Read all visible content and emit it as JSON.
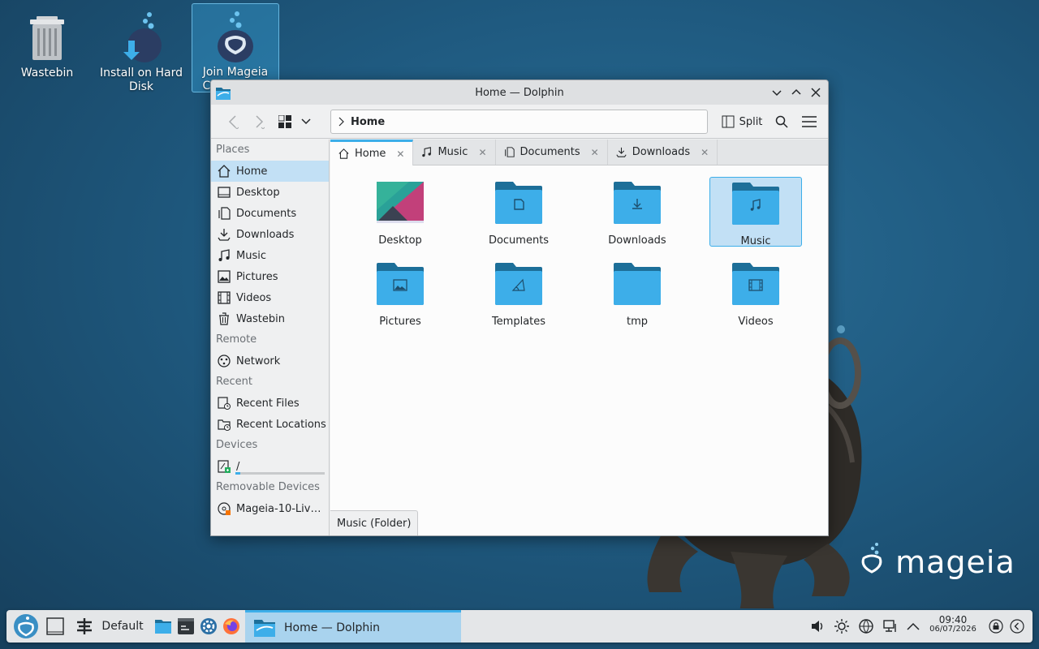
{
  "desktop": {
    "icons": [
      {
        "label": "Wastebin"
      },
      {
        "label": "Install on Hard Disk"
      },
      {
        "label": "Join Mageia Community"
      }
    ],
    "brand": "mageia"
  },
  "window": {
    "title": "Home — Dolphin",
    "breadcrumb": "Home",
    "split_label": "Split",
    "sidebar": {
      "sections": [
        {
          "heading": "Places",
          "items": [
            {
              "label": "Home",
              "icon": "home-icon",
              "active": true
            },
            {
              "label": "Desktop",
              "icon": "desktop-icon"
            },
            {
              "label": "Documents",
              "icon": "documents-icon"
            },
            {
              "label": "Downloads",
              "icon": "downloads-icon"
            },
            {
              "label": "Music",
              "icon": "music-icon"
            },
            {
              "label": "Pictures",
              "icon": "pictures-icon"
            },
            {
              "label": "Videos",
              "icon": "videos-icon"
            },
            {
              "label": "Wastebin",
              "icon": "wastebin-icon"
            }
          ]
        },
        {
          "heading": "Remote",
          "items": [
            {
              "label": "Network",
              "icon": "network-icon"
            }
          ]
        },
        {
          "heading": "Recent",
          "items": [
            {
              "label": "Recent Files",
              "icon": "recent-files-icon"
            },
            {
              "label": "Recent Locations",
              "icon": "recent-locations-icon"
            }
          ]
        },
        {
          "heading": "Devices",
          "items": [
            {
              "label": "/",
              "icon": "drive-icon"
            }
          ]
        },
        {
          "heading": "Removable Devices",
          "items": [
            {
              "label": "Mageia-10-Liv…",
              "icon": "optical-disc-icon"
            }
          ]
        }
      ]
    },
    "tabs": [
      {
        "label": "Home",
        "icon": "home-icon",
        "active": true
      },
      {
        "label": "Music",
        "icon": "music-icon"
      },
      {
        "label": "Documents",
        "icon": "documents-icon"
      },
      {
        "label": "Downloads",
        "icon": "downloads-icon"
      }
    ],
    "files": [
      {
        "label": "Desktop",
        "kind": "desktop"
      },
      {
        "label": "Documents",
        "kind": "documents"
      },
      {
        "label": "Downloads",
        "kind": "downloads"
      },
      {
        "label": "Music",
        "kind": "music",
        "selected": true
      },
      {
        "label": "Pictures",
        "kind": "pictures"
      },
      {
        "label": "Templates",
        "kind": "templates"
      },
      {
        "label": "tmp",
        "kind": "plain"
      },
      {
        "label": "Videos",
        "kind": "videos"
      }
    ],
    "status": "Music (Folder)",
    "device_usage": 0.05
  },
  "panel": {
    "activity": "Default",
    "task_title": "Home — Dolphin",
    "time": "09:40",
    "date": "06/07/2026"
  },
  "colors": {
    "accent": "#3daee9",
    "folder": "#3daee9",
    "folder_dark": "#1d6f99",
    "selection": "#c2e0f5"
  }
}
